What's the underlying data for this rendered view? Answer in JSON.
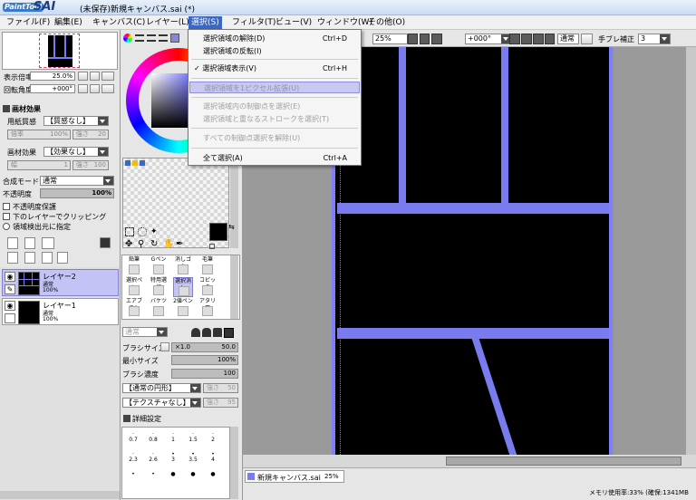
{
  "window": {
    "logo_small": "PaintTool",
    "logo_big": "SAI",
    "title": "(未保存)新規キャンバス.sai (*)"
  },
  "menu": [
    {
      "label": "ファイル(F)"
    },
    {
      "label": "編集(E)"
    },
    {
      "label": "キャンバス(C)"
    },
    {
      "label": "レイヤー(L)"
    },
    {
      "label": "選択(S)"
    },
    {
      "label": "フィルタ(T)"
    },
    {
      "label": "ビュー(V)"
    },
    {
      "label": "ウィンドウ(W)"
    },
    {
      "label": "その他(O)"
    }
  ],
  "select_menu": {
    "items": [
      {
        "label": "選択領域の解除(D)",
        "shortcut": "Ctrl+D"
      },
      {
        "label": "選択領域の反転(I)",
        "shortcut": ""
      },
      {
        "label": "✓ 選択領域表示(V)",
        "shortcut": "Ctrl+H"
      },
      {
        "label": "選択領域を1ピクセル拡張(U)",
        "shortcut": ""
      },
      {
        "label": "選択領域内の制御点を選択(E)",
        "shortcut": ""
      },
      {
        "label": "選択領域と重なるストロークを選択(T)",
        "shortcut": ""
      },
      {
        "label": "すべての制御点選択を解除(U)",
        "shortcut": ""
      },
      {
        "label": "全て選択(A)",
        "shortcut": "Ctrl+A"
      }
    ]
  },
  "navigator": {
    "zoom_label": "表示倍率",
    "zoom_value": "25.0%",
    "rotate_label": "回転角度",
    "rotate_value": "+000°"
  },
  "texture": {
    "section": "画材効果",
    "paper_label": "用紙質感",
    "paper_value": "【質感なし】",
    "paper_sub_left": "倍率",
    "paper_sub_mid": "100%",
    "paper_sub_right_label": "強さ",
    "paper_sub_right": "20",
    "effect_label": "画材効果",
    "effect_value": "【効果なし】",
    "effect_sub_left": "幅",
    "effect_sub_mid": "1",
    "effect_sub_right_label": "強さ",
    "effect_sub_right": "100"
  },
  "layer_props": {
    "blend_label": "合成モード",
    "blend_value": "通常",
    "opacity_label": "不透明度",
    "opacity_value": "100%",
    "opt_protect": "不透明度保護",
    "opt_clip": "下のレイヤーでクリッピング",
    "opt_source": "領域検出元に指定"
  },
  "layers": [
    {
      "name": "レイヤー2",
      "mode": "通常",
      "opacity": "100%"
    },
    {
      "name": "レイヤー1",
      "mode": "通常",
      "opacity": "100%"
    }
  ],
  "tools": [
    {
      "label": "鉛筆"
    },
    {
      "label": "Gペン"
    },
    {
      "label": "消しゴム"
    },
    {
      "label": "毛筆"
    },
    {
      "label": "選択ペン"
    },
    {
      "label": "特用選択"
    },
    {
      "label": "選択消し"
    },
    {
      "label": "コピック"
    },
    {
      "label": "エアブラシ"
    },
    {
      "label": "バケツ"
    },
    {
      "label": "2値ペン"
    },
    {
      "label": "アタリ用"
    }
  ],
  "brush": {
    "mode": "通常",
    "size_label": "ブラシサイズ",
    "size_mult": "×1.0",
    "size_value": "50.0",
    "min_label": "最小サイズ",
    "min_value": "100%",
    "density_label": "ブラシ濃度",
    "density_value": "100",
    "shape_value": "【通常の円形】",
    "shape_strength_label": "強さ",
    "shape_strength": "50",
    "texture_value": "【テクスチャなし】",
    "texture_strength_label": "強さ",
    "texture_strength": "95",
    "detail_label": "詳細設定",
    "sizes_row1": [
      "0.7",
      "0.8",
      "1",
      "1.5",
      "2"
    ],
    "sizes_row2": [
      "2.3",
      "2.6",
      "3",
      "3.5",
      "4"
    ]
  },
  "canvas_toolbar": {
    "zoom": "25%",
    "rotation": "+000°",
    "blend": "通常",
    "stab_label": "手ブレ補正",
    "stab_value": "3"
  },
  "document_tab": {
    "name": "新規キャンバス.sai",
    "zoom": "25%"
  },
  "status": {
    "memory": "メモリ使用率:33% (確保:1341MB"
  },
  "colors": {
    "accent": "#7b7bf0",
    "canvas": "#000000",
    "selection_border": "#8080ff"
  }
}
